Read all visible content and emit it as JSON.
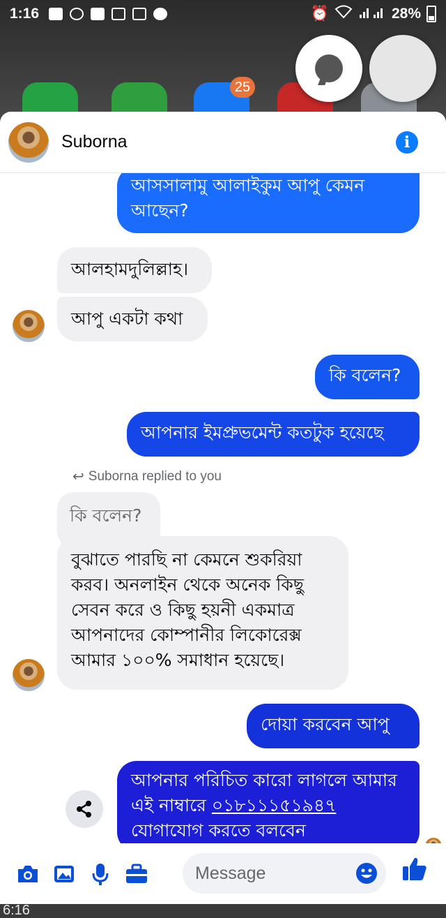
{
  "status_bar": {
    "time": "1:16",
    "battery": "28%"
  },
  "home_screen": {
    "badge_count": "25",
    "app_colors": [
      "#25a244",
      "#2e9e3e",
      "#1877f2",
      "#c62828",
      "#8a8f95"
    ]
  },
  "chat_header": {
    "contact_name": "Suborna",
    "icon": "info-icon"
  },
  "messages": {
    "m1": "আসসালামু আলাইকুম আপু কেমন আছেন?",
    "m2": "আলহামদুলিল্লাহ।",
    "m3": "আপু একটা কথা",
    "m4": "কি বলেন?",
    "m5": "আপনার ইমপ্রুভমেন্ট কতটুক হয়েছে",
    "reply_note": "Suborna replied to you",
    "quoted": "কি বলেন?",
    "m6": "বুঝাতে পারছি না কেমনে শুকরিয়া করব। অনলাইন থেকে অনেক কিছু সেবন করে ও কিছু হয়নী একমাত্র আপনাদের কোম্পানীর লিকোরেক্স আমার ১০০% সমাধান হয়েছে।",
    "m7": "দোয়া করবেন আপু",
    "m8_prefix": "আপনার পরিচিত কারো লাগলে আমার এই নাম্বারে",
    "m8_phone": "০১৮১১১৫১৯৪৭",
    "m8_suffix": "যোগাযোগ করতে বলবেন"
  },
  "composer": {
    "placeholder": "Message",
    "icons": [
      "camera-icon",
      "gallery-icon",
      "microphone-icon",
      "briefcase-icon",
      "emoji-icon",
      "thumbs-up-icon"
    ]
  },
  "nav_bar": {
    "time": "6:16"
  },
  "colors": {
    "messenger_blue": "#0a7cff",
    "out_bubble_top": "#1a6cff",
    "out_bubble_bottom": "#1d1fd6",
    "incoming_bubble": "#f0f0f3"
  }
}
